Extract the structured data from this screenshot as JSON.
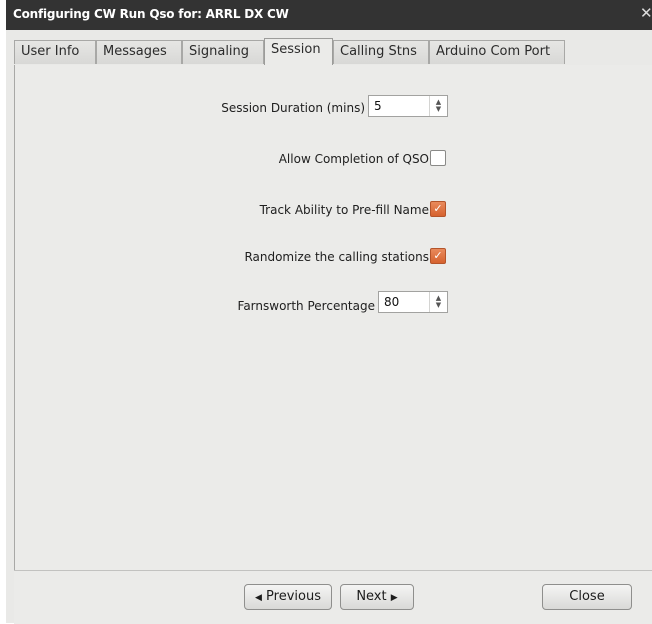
{
  "window": {
    "title": "Configuring CW Run Qso for: ARRL DX CW",
    "close_glyph": "✕"
  },
  "tabs": [
    {
      "label": "User Info",
      "active": false
    },
    {
      "label": "Messages",
      "active": false
    },
    {
      "label": "Signaling",
      "active": false
    },
    {
      "label": "Session",
      "active": true
    },
    {
      "label": "Calling Stns",
      "active": false
    },
    {
      "label": "Arduino Com Port",
      "active": false
    }
  ],
  "session": {
    "duration": {
      "label": "Session Duration (mins)",
      "value": "5"
    },
    "allow_completion": {
      "label": "Allow Completion of QSO",
      "checked": false
    },
    "track_prefill": {
      "label": "Track Ability to Pre-fill Name",
      "checked": true
    },
    "randomize": {
      "label": "Randomize the calling stations",
      "checked": true
    },
    "farnsworth": {
      "label": "Farnsworth Percentage",
      "value": "80"
    }
  },
  "buttons": {
    "previous": "Previous",
    "next": "Next",
    "close": "Close"
  },
  "glyphs": {
    "check": "✓",
    "spin_up": "▲",
    "spin_down": "▼",
    "left": "◀",
    "right": "▶"
  },
  "colors": {
    "titlebar": "#333333",
    "checkbox_checked": "#d6622e",
    "panel": "#ebebe9"
  }
}
